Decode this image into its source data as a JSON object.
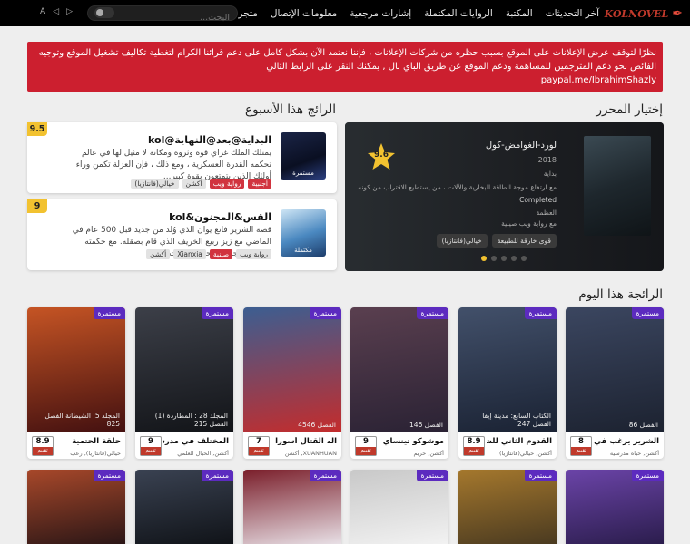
{
  "nav": {
    "logo_text": "KOLNOVEL",
    "links": [
      "آخر التحديثات",
      "المكتبة",
      "الروايات المكتملة",
      "إشارات مرجعية",
      "معلومات الإتصال",
      "متجر العملات"
    ],
    "search_placeholder": "البحث...",
    "icons_text": "◐ ◑ ◒"
  },
  "notice": {
    "text": "نظرًا لتوقف عرض الإعلانات على الموقع بسبب حظره من شركات الإعلانات ، فإننا نعتمد الآن بشكل كامل على دعم قرائنا الكرام لتغطية تكاليف تشغيل الموقع وتوجيه الفائض نحو دعم المترجمين للمساهمة ودعم الموقع عن طريق الباي بال , يمكنك النقر على الرابط التالي",
    "link": "paypal.me/IbrahimShazly"
  },
  "weekly": {
    "title": "الرائج هذا الأسبوع",
    "items": [
      {
        "title": "البداية@بعد@النهاية@kol",
        "desc": "يمتلك الملك غراي قوة وثروة ومكانة لا مثيل لها في عالم تحكمه القدرة العسكرية ، ومع ذلك ، فإن العزلة تكمن وراء أولئك الذين يتمتعون بقوة كبير...",
        "status": "مستمرة",
        "score": "9.5",
        "tags": [
          "أجنبية",
          "رواية ويب",
          "أكشن",
          "خيالي(فانتازيا)"
        ]
      },
      {
        "title": "القس&المجنون&kol",
        "desc": "قصة الشرير فانغ يوان الذي وُلد من جديد قبل 500 عام في الماضي مع زيز ربيع الخريف الذي قام بصقله. مع حكمته العميقة وتجارب الحياة والموت...",
        "status": "مكتملة",
        "score": "9",
        "tags": [
          "رواية ويب",
          "صينية",
          "Xianxia",
          "أكشن"
        ]
      }
    ]
  },
  "editor": {
    "title": "إختيار المحرر",
    "novel_title": "لورد-الغوامض-كول",
    "year": "2018",
    "line1": "بداية",
    "line2": "مع ارتفاع موجة الطاقة البخارية والآلات ، من يستطيع الاقتراب من كونه",
    "status": "Completed",
    "line3": "العظمة",
    "line4": "مع رواية ويب صينية",
    "score": "9.6",
    "tags": [
      "قوى خارقة للطبيعة",
      "خيالي(فانتازيا)"
    ]
  },
  "today": {
    "title": "الرائجة هذا اليوم",
    "novels": [
      {
        "status": "مستمرة",
        "chapter": "الفصل 86",
        "title": "الشرير يرغب في ال...",
        "genre": "أكشن, حياة مدرسية",
        "score": "8",
        "cover": [
          "#1c2230",
          "#3b4660"
        ]
      },
      {
        "status": "مستمرة",
        "chapter": "الكتاب السابع: مدينة إيفا\nالفصل 247",
        "title": "القدوم الثاني للشره",
        "genre": "أكشن, خيالي(فانتازيا)",
        "score": "8.9",
        "cover": [
          "#1a2233",
          "#42506a"
        ]
      },
      {
        "status": "مستمرة",
        "chapter": "الفصل 146",
        "title": "موشوكو تينساي",
        "genre": "أكشن, حريم",
        "score": "9",
        "cover": [
          "#2a2234",
          "#5a3f4f"
        ]
      },
      {
        "status": "مستمرة",
        "chapter": "الفصل 4546",
        "title": "اله القتال أسورا",
        "genre": "XUANHUAN, أكشن",
        "score": "7",
        "cover": [
          "#c42c2c",
          "#3c5e91"
        ]
      },
      {
        "status": "مستمرة",
        "chapter": "المجلد 28 : المطاردة (1)\nالفصل 215",
        "title": "المختلف في مدرسة...",
        "genre": "أكشن, الخيال العلمي",
        "score": "9",
        "cover": [
          "#121418",
          "#3c3f48"
        ]
      },
      {
        "status": "مستمرة",
        "chapter": "المجلد 5: الشيطانة الفصل\n825",
        "title": "حلقة الحتمية",
        "genre": "خيالي(فانتازيا), رعب",
        "score": "8.9",
        "cover": [
          "#431010",
          "#c55424"
        ]
      }
    ],
    "row2": [
      {
        "status": "مستمرة",
        "cover": [
          "#2b1d4d",
          "#6b44a8"
        ]
      },
      {
        "status": "مستمرة",
        "cover": [
          "#4a3a20",
          "#a5782d"
        ]
      },
      {
        "status": "مستمرة",
        "cover": [
          "#f2f2f2",
          "#c8c8c8"
        ]
      },
      {
        "status": "مستمرة",
        "cover": [
          "#e8e0e6",
          "#7a1e2a"
        ]
      },
      {
        "status": "مستمرة",
        "cover": [
          "#101318",
          "#3a4252"
        ]
      },
      {
        "status": "مستمرة",
        "cover": [
          "#2b1616",
          "#a8482a"
        ]
      }
    ],
    "score_label": "تقييم"
  }
}
